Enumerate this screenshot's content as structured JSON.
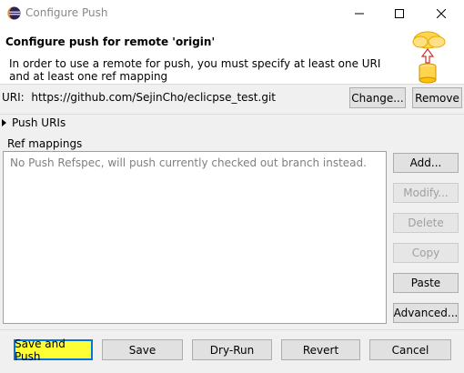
{
  "window": {
    "title": "Configure Push",
    "minimize_icon": "minimize-icon",
    "maximize_icon": "maximize-icon",
    "close_icon": "close-icon"
  },
  "header": {
    "title": "Configure push for remote 'origin'",
    "description": "In order to use a remote for push, you must specify at least one URI and at least one ref mapping",
    "image_icon": "cloud-push-database-icon"
  },
  "uri": {
    "label": "URI:",
    "value": "https://github.com/SejinCho/eclicpse_test.git",
    "change_button": "Change...",
    "remove_button": "Remove"
  },
  "push_uris": {
    "label": "Push URIs"
  },
  "ref_mappings": {
    "label": "Ref mappings",
    "placeholder": "No Push Refspec, will push currently checked out branch instead.",
    "buttons": {
      "add": "Add...",
      "modify": "Modify...",
      "delete": "Delete",
      "copy": "Copy",
      "paste": "Paste",
      "advanced": "Advanced..."
    }
  },
  "footer": {
    "save_and_push": "Save and Push",
    "save": "Save",
    "dry_run": "Dry-Run",
    "revert": "Revert",
    "cancel": "Cancel"
  },
  "colors": {
    "highlight": "#ffff33",
    "focus_border": "#0078d7"
  }
}
